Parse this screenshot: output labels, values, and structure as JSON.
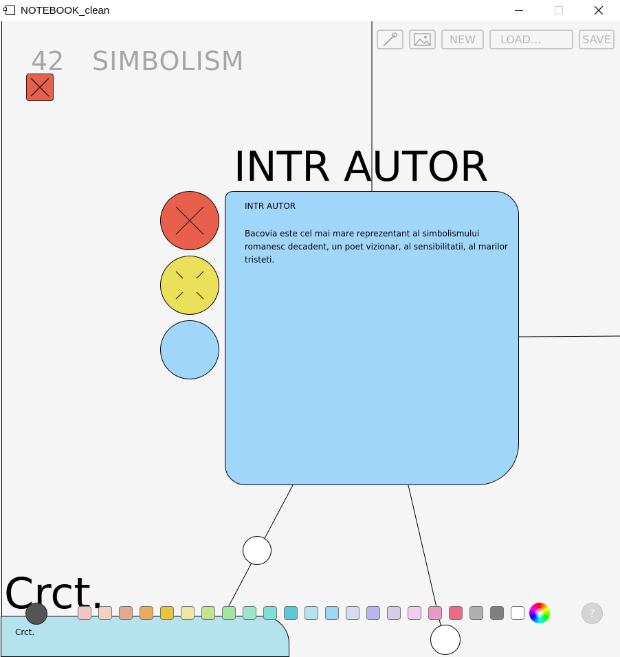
{
  "window": {
    "title": "NOTEBOOK_clean"
  },
  "header": {
    "page_number": "42",
    "page_name": "SIMBOLISM"
  },
  "toolbar": {
    "eyedropper_icon": "eyedropper-icon",
    "image_icon": "image-icon",
    "new_label": "NEW",
    "load_label": "LOAD...",
    "save_label": "SAVE"
  },
  "node": {
    "title": "INTR AUTOR",
    "card_heading": "INTR AUTOR",
    "card_body": "Bacovia este cel mai mare reprezentant al simbolismului romanesc decadent, un poet vizionar, al sensibilitatii, al marilor tristeti.",
    "card_color": "#a1d6fb"
  },
  "side_buttons": [
    {
      "name": "delete",
      "color": "#e8604c",
      "icon": "close-icon"
    },
    {
      "name": "expand",
      "color": "#ebe05a",
      "icon": "collapse-icon"
    },
    {
      "name": "color",
      "color": "#a1d6fb",
      "icon": ""
    }
  ],
  "bottom_node": {
    "title": "Crct.",
    "card_label": "Crct.",
    "card_color": "#b5e3ed"
  },
  "palette": [
    "#f2c6c6",
    "#f0d3c0",
    "#e0ac8e",
    "#e8ac5a",
    "#e4c53c",
    "#ece7a3",
    "#c4e38b",
    "#9de7a0",
    "#9be7cc",
    "#7fded6",
    "#5dc9d6",
    "#b5e3ed",
    "#a1d6fb",
    "#d4dcee",
    "#b8b8ef",
    "#d6cde9",
    "#efcdef",
    "#e99ac6",
    "#f06a87",
    "#b0b0b0",
    "#808080",
    "#ffffff"
  ],
  "help_label": "?"
}
